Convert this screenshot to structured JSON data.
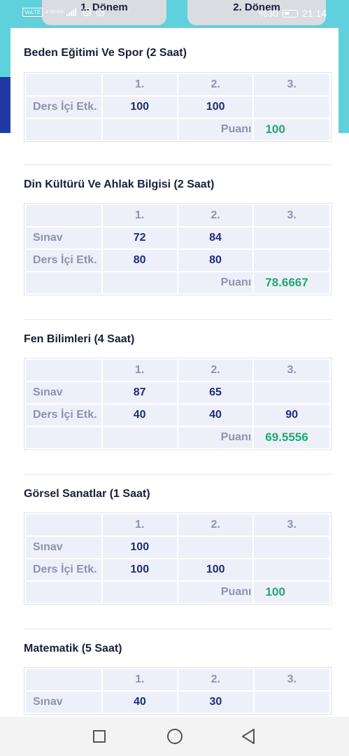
{
  "tabs": [
    "1. Dönem",
    "2. Dönem"
  ],
  "status": {
    "network": "VoLTE",
    "speed": "4.50 K/s",
    "battery_text": "%30",
    "time": "21:14"
  },
  "subjects": [
    {
      "title": "Beden Eğitimi Ve Spor (2 Saat)",
      "headers": [
        "1.",
        "2.",
        "3."
      ],
      "rows": [
        {
          "label": "Ders İçi Etk.",
          "values": [
            "100",
            "100",
            ""
          ]
        }
      ],
      "puan_label": "Puanı",
      "puan": "100"
    },
    {
      "title": "Din Kültürü Ve Ahlak Bilgisi (2 Saat)",
      "headers": [
        "1.",
        "2.",
        "3."
      ],
      "rows": [
        {
          "label": "Sınav",
          "values": [
            "72",
            "84",
            ""
          ]
        },
        {
          "label": "Ders İçi Etk.",
          "values": [
            "80",
            "80",
            ""
          ]
        }
      ],
      "puan_label": "Puanı",
      "puan": "78.6667"
    },
    {
      "title": "Fen Bilimleri (4 Saat)",
      "headers": [
        "1.",
        "2.",
        "3."
      ],
      "rows": [
        {
          "label": "Sınav",
          "values": [
            "87",
            "65",
            ""
          ]
        },
        {
          "label": "Ders İçi Etk.",
          "values": [
            "40",
            "40",
            "90"
          ]
        }
      ],
      "puan_label": "Puanı",
      "puan": "69.5556"
    },
    {
      "title": "Görsel Sanatlar (1 Saat)",
      "headers": [
        "1.",
        "2.",
        "3."
      ],
      "rows": [
        {
          "label": "Sınav",
          "values": [
            "100",
            "",
            ""
          ]
        },
        {
          "label": "Ders İçi Etk.",
          "values": [
            "100",
            "100",
            ""
          ]
        }
      ],
      "puan_label": "Puanı",
      "puan": "100"
    },
    {
      "title": "Matematik (5 Saat)",
      "headers": [
        "1.",
        "2.",
        "3."
      ],
      "rows": [
        {
          "label": "Sınav",
          "values": [
            "40",
            "30",
            ""
          ]
        }
      ],
      "puan_label": "",
      "puan": ""
    }
  ],
  "navbar": [
    "recents-button",
    "home-button",
    "back-button"
  ]
}
